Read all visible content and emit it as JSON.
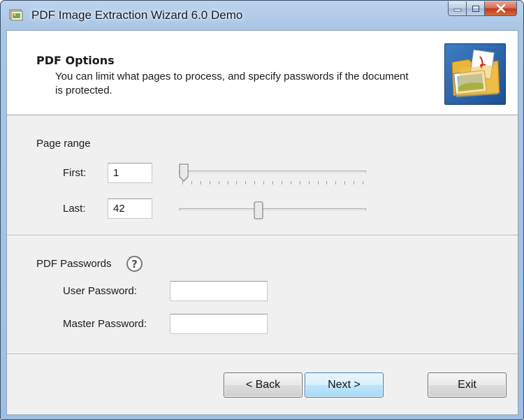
{
  "window": {
    "title": "PDF Image Extraction Wizard 6.0 Demo",
    "icon": "pdf-wizard-app-icon"
  },
  "header": {
    "title": "PDF Options",
    "description": "You can limit what pages to process, and specify passwords if the document is protected.",
    "image_icon": "pdf-images-folder-icon"
  },
  "page_range": {
    "group_label": "Page range",
    "first_label": "First:",
    "first_value": "1",
    "last_label": "Last:",
    "last_value": "42",
    "first_slider_fraction": 0.0,
    "last_slider_fraction": 0.42
  },
  "passwords": {
    "group_label": "PDF Passwords",
    "help_icon": "help-icon",
    "help_glyph": "?",
    "user_label": "User Password:",
    "user_value": "",
    "master_label": "Master Password:",
    "master_value": ""
  },
  "buttons": {
    "back": "< Back",
    "next": "Next >",
    "exit": "Exit"
  },
  "colors": {
    "close_button": "#c0391c",
    "default_button_border": "#3c7fb1",
    "header_image": "#1d4f93"
  }
}
